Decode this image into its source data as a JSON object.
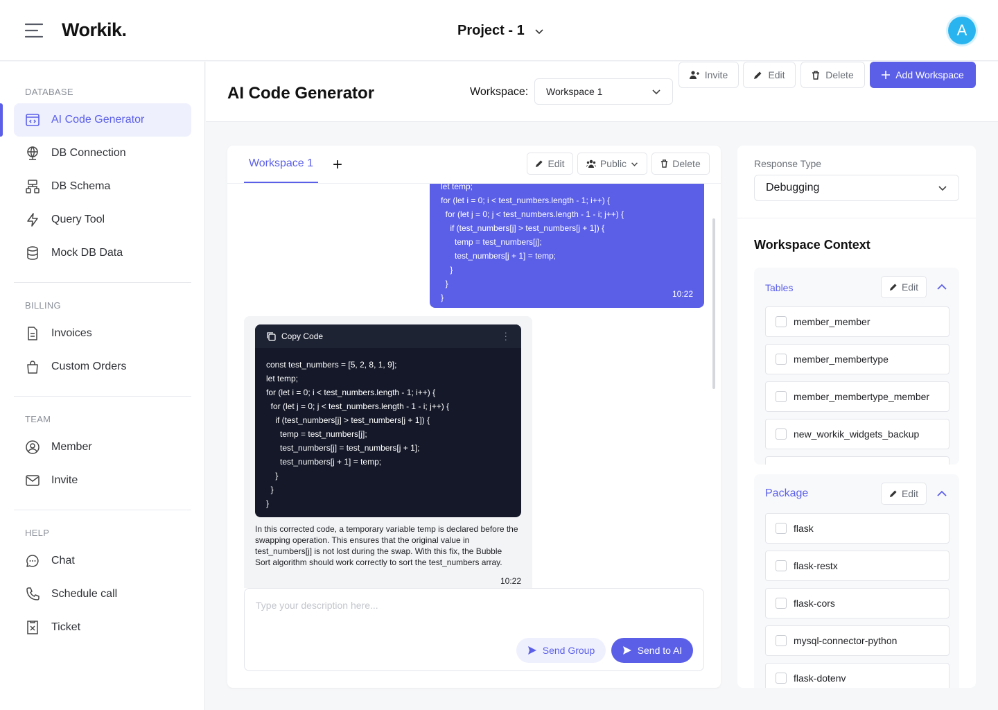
{
  "app": {
    "logo": "Workik.",
    "project": "Project - 1",
    "avatar": "A"
  },
  "sidebar": {
    "sections": [
      {
        "title": "DATABASE",
        "items": [
          "AI Code Generator",
          "DB Connection",
          "DB Schema",
          "Query Tool",
          "Mock DB Data"
        ]
      },
      {
        "title": "BILLING",
        "items": [
          "Invoices",
          "Custom Orders"
        ]
      },
      {
        "title": "TEAM",
        "items": [
          "Member",
          "Invite"
        ]
      },
      {
        "title": "HELP",
        "items": [
          "Chat",
          "Schedule call",
          "Ticket"
        ]
      }
    ],
    "active": "AI Code Generator"
  },
  "header": {
    "title": "AI Code Generator",
    "workspace_label": "Workspace:",
    "workspace_value": "Workspace 1",
    "invite": "Invite",
    "edit": "Edit",
    "delete": "Delete",
    "add": "Add Workspace"
  },
  "chat": {
    "tab": "Workspace 1",
    "edit": "Edit",
    "visibility": "Public",
    "delete": "Delete",
    "user_code": "let temp;\nfor (let i = 0; i < test_numbers.length - 1; i++) {\n  for (let j = 0; j < test_numbers.length - 1 - i; j++) {\n    if (test_numbers[j] > test_numbers[j + 1]) {\n      temp = test_numbers[j];\n      test_numbers[j + 1] = temp;\n    }\n  }\n}",
    "user_time": "10:22",
    "copy_label": "Copy Code",
    "ai_code": "const test_numbers = [5, 2, 8, 1, 9];\nlet temp;\nfor (let i = 0; i < test_numbers.length - 1; i++) {\n  for (let j = 0; j < test_numbers.length - 1 - i; j++) {\n    if (test_numbers[j] > test_numbers[j + 1]) {\n      temp = test_numbers[j];\n      test_numbers[j] = test_numbers[j + 1];\n      test_numbers[j + 1] = temp;\n    }\n  }\n}",
    "ai_text": "In this corrected code, a temporary variable temp is declared before the swapping operation. This ensures that the original value in test_numbers[j] is not lost during the swap. With this fix, the Bubble Sort algorithm should work correctly to sort the test_numbers array.",
    "ai_time": "10:22",
    "placeholder": "Type your description here...",
    "send_group": "Send Group",
    "send_ai": "Send to AI"
  },
  "context": {
    "response_label": "Response Type",
    "response_value": "Debugging",
    "title": "Workspace Context",
    "tables_title": "Tables",
    "tables": [
      "member_member",
      "member_membertype",
      "member_membertype_member",
      "new_workik_widgets_backup"
    ],
    "package_title": "Package",
    "packages": [
      "flask",
      "flask-restx",
      "flask-cors",
      "mysql-connector-python",
      "flask-dotenv"
    ],
    "edit": "Edit"
  },
  "colors": {
    "accent": "#5b5fe8",
    "code_bg": "#141828",
    "avatar": "#2ab4ef"
  }
}
